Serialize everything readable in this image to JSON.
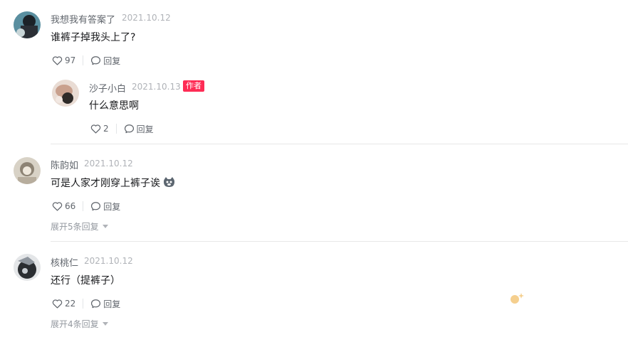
{
  "comments": [
    {
      "name": "我想我有答案了",
      "date": "2021.10.12",
      "text": "谁裤子掉我头上了?",
      "likes": "97",
      "reply_label": "回复",
      "reply": {
        "name": "沙子小白",
        "date": "2021.10.13",
        "badge": "作者",
        "text": "什么意思啊",
        "likes": "2",
        "reply_label": "回复"
      }
    },
    {
      "name": "陈韵如",
      "date": "2021.10.12",
      "text": "可是人家才刚穿上裤子诶",
      "emoji": "cat-face-icon",
      "likes": "66",
      "reply_label": "回复",
      "expand_label": "展开5条回复"
    },
    {
      "name": "核桃仁",
      "date": "2021.10.12",
      "text": "还行（提裤子）",
      "likes": "22",
      "reply_label": "回复",
      "expand_label": "展开4条回复"
    }
  ],
  "colors": {
    "author_badge": "#fe2c55",
    "name": "#61666d",
    "date": "#b0b3b8",
    "text": "#18191c"
  }
}
